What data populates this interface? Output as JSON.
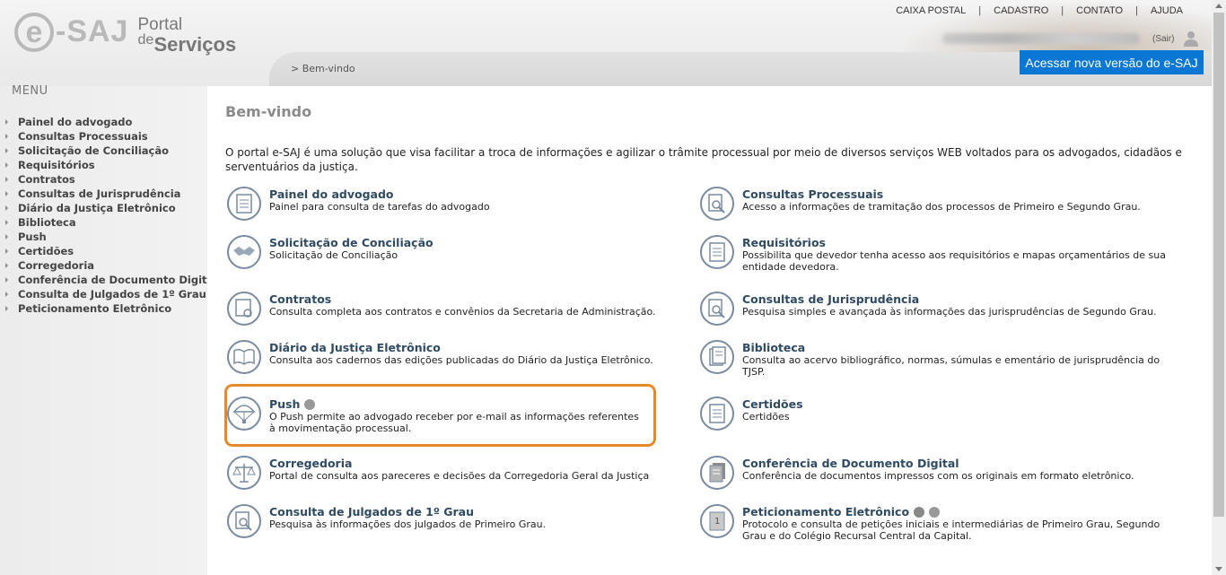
{
  "header": {
    "logo": {
      "e": "e",
      "saj": "-SAJ",
      "portal": "Portal",
      "de": "de",
      "servicos": "Serviços"
    },
    "top_links": [
      "CAIXA POSTAL",
      "CADASTRO",
      "CONTATO",
      "AJUDA"
    ],
    "logout": "(Sair)",
    "breadcrumb": "> Bem-vindo",
    "new_version_button": "Acessar nova versão do e-SAJ"
  },
  "sidebar": {
    "title": "MENU",
    "items": [
      "Painel do advogado",
      "Consultas Processuais",
      "Solicitação de Conciliação",
      "Requisitórios",
      "Contratos",
      "Consultas de Jurisprudência",
      "Diário da Justiça Eletrônico",
      "Biblioteca",
      "Push",
      "Certidões",
      "Corregedoria",
      "Conferência de Documento Digital",
      "Consulta de Julgados de 1º Grau",
      "Peticionamento Eletrônico"
    ]
  },
  "main": {
    "title": "Bem-vindo",
    "intro": "O portal e-SAJ é uma solução que visa facilitar a troca de informações e agilizar o trâmite processual por meio de diversos serviços WEB voltados para os advogados, cidadãos e serventuários da justiça.",
    "services_left": [
      {
        "name": "Painel do advogado",
        "desc": "Painel para consulta de tarefas do advogado",
        "icon": "document-icon"
      },
      {
        "name": "Solicitação de Conciliação",
        "desc": "Solicitação de Conciliação",
        "icon": "handshake-icon"
      },
      {
        "name": "Contratos",
        "desc": "Consulta completa aos contratos e convênios da Secretaria de Administração.",
        "icon": "certificate-icon"
      },
      {
        "name": "Diário da Justiça Eletrônico",
        "desc": "Consulta aos cadernos das edições publicadas do Diário da Justiça Eletrônico.",
        "icon": "open-book-icon"
      },
      {
        "name": "Push",
        "desc": "O Push permite ao advogado receber por e-mail as informações referentes à movimentação processual.",
        "icon": "parachute-icon"
      },
      {
        "name": "Corregedoria",
        "desc": "Portal de consulta aos pareceres e decisões da Corregedoria Geral da Justiça",
        "icon": "scales-icon"
      },
      {
        "name": "Consulta de Julgados de 1º Grau",
        "desc": "Pesquisa às informações dos julgados de Primeiro Grau.",
        "icon": "magnifier-doc-icon"
      }
    ],
    "services_right": [
      {
        "name": "Consultas Processuais",
        "desc": "Acesso a informações de tramitação dos processos de Primeiro e Segundo Grau.",
        "icon": "magnifier-doc-icon"
      },
      {
        "name": "Requisitórios",
        "desc": "Possibilita que devedor tenha acesso aos requisitórios e mapas orçamentários de sua entidade devedora.",
        "icon": "document-icon"
      },
      {
        "name": "Consultas de Jurisprudência",
        "desc": "Pesquisa simples e avançada às informações das jurisprudências de Segundo Grau.",
        "icon": "magnifier-doc-icon"
      },
      {
        "name": "Biblioteca",
        "desc": "Consulta ao acervo bibliográfico, normas, súmulas e ementário de jurisprudência do TJSP.",
        "icon": "books-icon"
      },
      {
        "name": "Certidões",
        "desc": "Certidões",
        "icon": "document-icon"
      },
      {
        "name": "Conferência de Documento Digital",
        "desc": "Conferência de documentos impressos com os originais em formato eletrônico.",
        "icon": "stacked-docs-icon"
      },
      {
        "name": "Peticionamento Eletrônico",
        "desc": "Protocolo e consulta de petições iniciais e intermediárias de Primeiro Grau, Segundo Grau e do Colégio Recursal Central da Capital.",
        "icon": "petition-icon"
      }
    ],
    "badges": {
      "push": "user-badge-icon",
      "peticionamento": [
        "oab-badge-icon",
        "lock-badge-icon"
      ]
    },
    "colors": {
      "highlight": "#e48a28",
      "title_link": "#2f4a63",
      "button": "#0a77d5"
    }
  }
}
